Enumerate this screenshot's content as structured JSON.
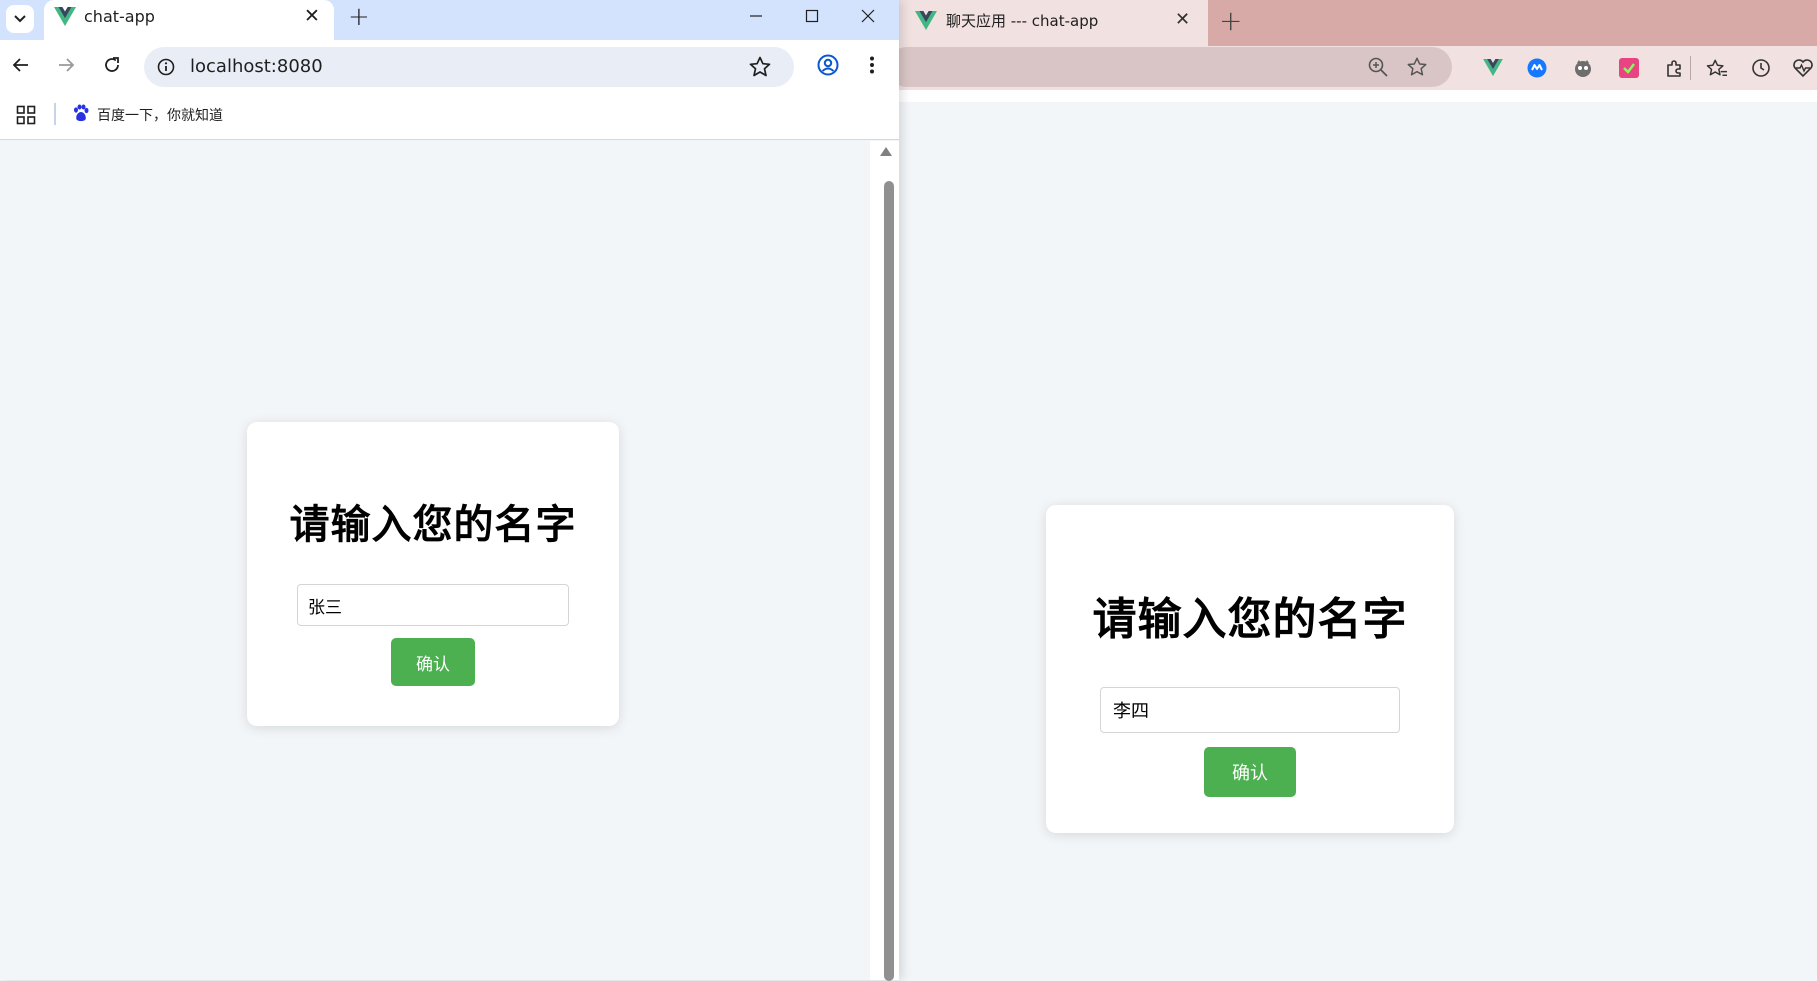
{
  "left_browser": {
    "tab_title": "chat-app",
    "url": "localhost:8080",
    "bookmark_label": "百度一下，你就知道",
    "card": {
      "heading": "请输入您的名字",
      "name_value": "张三",
      "confirm_label": "确认"
    }
  },
  "right_browser": {
    "tab_title": "聊天应用 --- chat-app",
    "card": {
      "heading": "请输入您的名字",
      "name_value": "李四",
      "confirm_label": "确认"
    }
  },
  "colors": {
    "accent_green": "#4caf50",
    "vue_green": "#41b883",
    "vue_dark": "#35495e",
    "page_bg": "#f3f6f9"
  },
  "icons": [
    "tab-search-icon",
    "vue-logo-icon",
    "close-icon",
    "plus-icon",
    "minimize-icon",
    "maximize-icon",
    "back-icon",
    "forward-icon",
    "reload-icon",
    "info-icon",
    "star-icon",
    "profile-icon",
    "more-icon",
    "apps-icon",
    "baidu-paw-icon",
    "zoom-icon",
    "extensions-icon",
    "favorites-icon",
    "history-icon"
  ]
}
